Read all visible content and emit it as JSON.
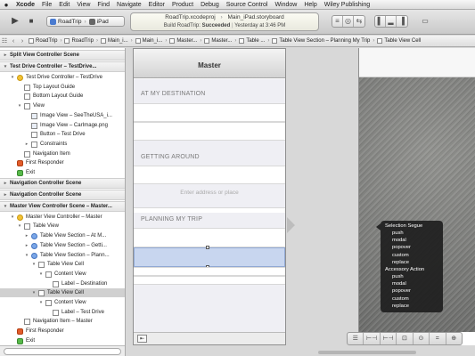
{
  "menubar": {
    "apple": "",
    "items": [
      "Xcode",
      "File",
      "Edit",
      "View",
      "Find",
      "Navigate",
      "Editor",
      "Product",
      "Debug",
      "Source Control",
      "Window",
      "Help",
      "Wiley Publishing"
    ]
  },
  "window": {
    "title_left": "RoadTrip.xcodeproj",
    "title_right": "Main_iPad.storyboard"
  },
  "toolbar": {
    "run_icon": "▶",
    "stop_icon": "■",
    "scheme": "RoadTrip",
    "device": "iPad",
    "status_line1": "",
    "status_line2_label": "Build RoadTrip:",
    "status_line2_result": "Succeeded",
    "status_line2_time": "Yesterday at 3:46 PM"
  },
  "jumpbar": {
    "crumbs": [
      "RoadTrip",
      "RoadTrip",
      "Main_i...",
      "Main_i...",
      "Master...",
      "Master...",
      "Table ...",
      "Table View Section – Planning My Trip",
      "Table View Cell"
    ]
  },
  "outline": {
    "rows": [
      {
        "type": "section",
        "label": "Split View Controller Scene",
        "indent": 0,
        "tri": "▸",
        "icon": ""
      },
      {
        "type": "section",
        "label": "Test Drive Controller – TestDrive...",
        "indent": 0,
        "tri": "▾",
        "icon": ""
      },
      {
        "type": "row",
        "label": "Test Drive Controller – TestDrive",
        "indent": 1,
        "tri": "▾",
        "icon": "yellow"
      },
      {
        "type": "row",
        "label": "Top Layout Guide",
        "indent": 2,
        "tri": "",
        "icon": "plain"
      },
      {
        "type": "row",
        "label": "Bottom Layout Guide",
        "indent": 2,
        "tri": "",
        "icon": "plain"
      },
      {
        "type": "row",
        "label": "View",
        "indent": 2,
        "tri": "▾",
        "icon": "plain"
      },
      {
        "type": "row",
        "label": "Image View – SeeTheUSA_i...",
        "indent": 3,
        "tri": "",
        "icon": "img"
      },
      {
        "type": "row",
        "label": "Image View – CarImage.png",
        "indent": 3,
        "tri": "",
        "icon": "img"
      },
      {
        "type": "row",
        "label": "Button – Test Drive",
        "indent": 3,
        "tri": "",
        "icon": "plain"
      },
      {
        "type": "row",
        "label": "Constraints",
        "indent": 3,
        "tri": "▸",
        "icon": "plain"
      },
      {
        "type": "row",
        "label": "Navigation Item",
        "indent": 2,
        "tri": "",
        "icon": "plain"
      },
      {
        "type": "row",
        "label": "First Responder",
        "indent": 1,
        "tri": "",
        "icon": "red"
      },
      {
        "type": "row",
        "label": "Exit",
        "indent": 1,
        "tri": "",
        "icon": "green"
      },
      {
        "type": "section",
        "label": "Navigation Controller Scene",
        "indent": 0,
        "tri": "▸",
        "icon": ""
      },
      {
        "type": "section",
        "label": "Navigation Controller Scene",
        "indent": 0,
        "tri": "▸",
        "icon": ""
      },
      {
        "type": "section",
        "label": "Master View Controller Scene – Master...",
        "indent": 0,
        "tri": "▾",
        "icon": ""
      },
      {
        "type": "row",
        "label": "Master View Controller – Master",
        "indent": 1,
        "tri": "▾",
        "icon": "yellow"
      },
      {
        "type": "row",
        "label": "Table View",
        "indent": 2,
        "tri": "▾",
        "icon": "plain"
      },
      {
        "type": "row",
        "label": "Table View Section – At M...",
        "indent": 3,
        "tri": "▸",
        "icon": "blue"
      },
      {
        "type": "row",
        "label": "Table View Section – Getti...",
        "indent": 3,
        "tri": "▸",
        "icon": "blue"
      },
      {
        "type": "row",
        "label": "Table View Section – Plann...",
        "indent": 3,
        "tri": "▾",
        "icon": "blue"
      },
      {
        "type": "row",
        "label": "Table View Cell",
        "indent": 4,
        "tri": "▾",
        "icon": "plain"
      },
      {
        "type": "row",
        "label": "Content View",
        "indent": 5,
        "tri": "▾",
        "icon": "plain"
      },
      {
        "type": "row",
        "label": "Label – Destination",
        "indent": 6,
        "tri": "",
        "icon": "plain"
      },
      {
        "type": "row",
        "label": "Table View Cell",
        "indent": 4,
        "tri": "▾",
        "icon": "plain",
        "selected": true
      },
      {
        "type": "row",
        "label": "Content View",
        "indent": 5,
        "tri": "▾",
        "icon": "plain"
      },
      {
        "type": "row",
        "label": "Label – Test Drive",
        "indent": 6,
        "tri": "",
        "icon": "plain"
      },
      {
        "type": "row",
        "label": "Navigation Item – Master",
        "indent": 2,
        "tri": "",
        "icon": "plain"
      },
      {
        "type": "row",
        "label": "First Responder",
        "indent": 1,
        "tri": "",
        "icon": "red"
      },
      {
        "type": "row",
        "label": "Exit",
        "indent": 1,
        "tri": "",
        "icon": "green"
      },
      {
        "type": "section",
        "label": "Detail View Controller – Detail Scene",
        "indent": 0,
        "tri": "▸",
        "icon": ""
      }
    ]
  },
  "master_scene": {
    "title": "Master",
    "sections": [
      "AT MY DESTINATION",
      "GETTING AROUND",
      "PLANNING MY TRIP"
    ],
    "placeholder": "Enter address or place"
  },
  "segue_hud": {
    "header1": "Selection Segue",
    "items1": [
      "push",
      "modal",
      "popover",
      "custom",
      "replace"
    ],
    "header2": "Accessory Action",
    "items2": [
      "push",
      "modal",
      "popover",
      "custom",
      "replace"
    ]
  },
  "zoom_bar": {
    "buttons": [
      "☰",
      "⊢⊣",
      "⊢⊣",
      "⊡",
      "⊙",
      "=",
      "⊕"
    ]
  }
}
